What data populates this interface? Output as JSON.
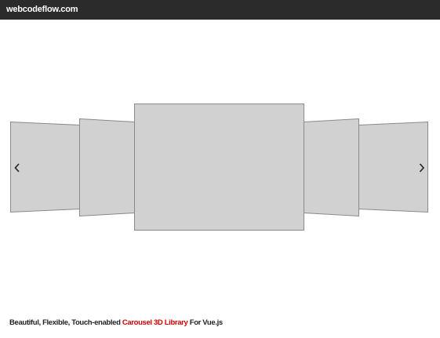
{
  "header": {
    "brand": "webcodeflow.com"
  },
  "carousel": {
    "prev_icon": "chevron-left-icon",
    "next_icon": "chevron-right-icon",
    "slide_count": 5,
    "active_index": 2,
    "slide_color": "#d1d1d1"
  },
  "footer": {
    "prefix": "Beautiful, Flexible, Touch-enabled ",
    "highlight": "Carousel 3D Library",
    "suffix": " For Vue.js",
    "highlight_color": "#d40000"
  }
}
